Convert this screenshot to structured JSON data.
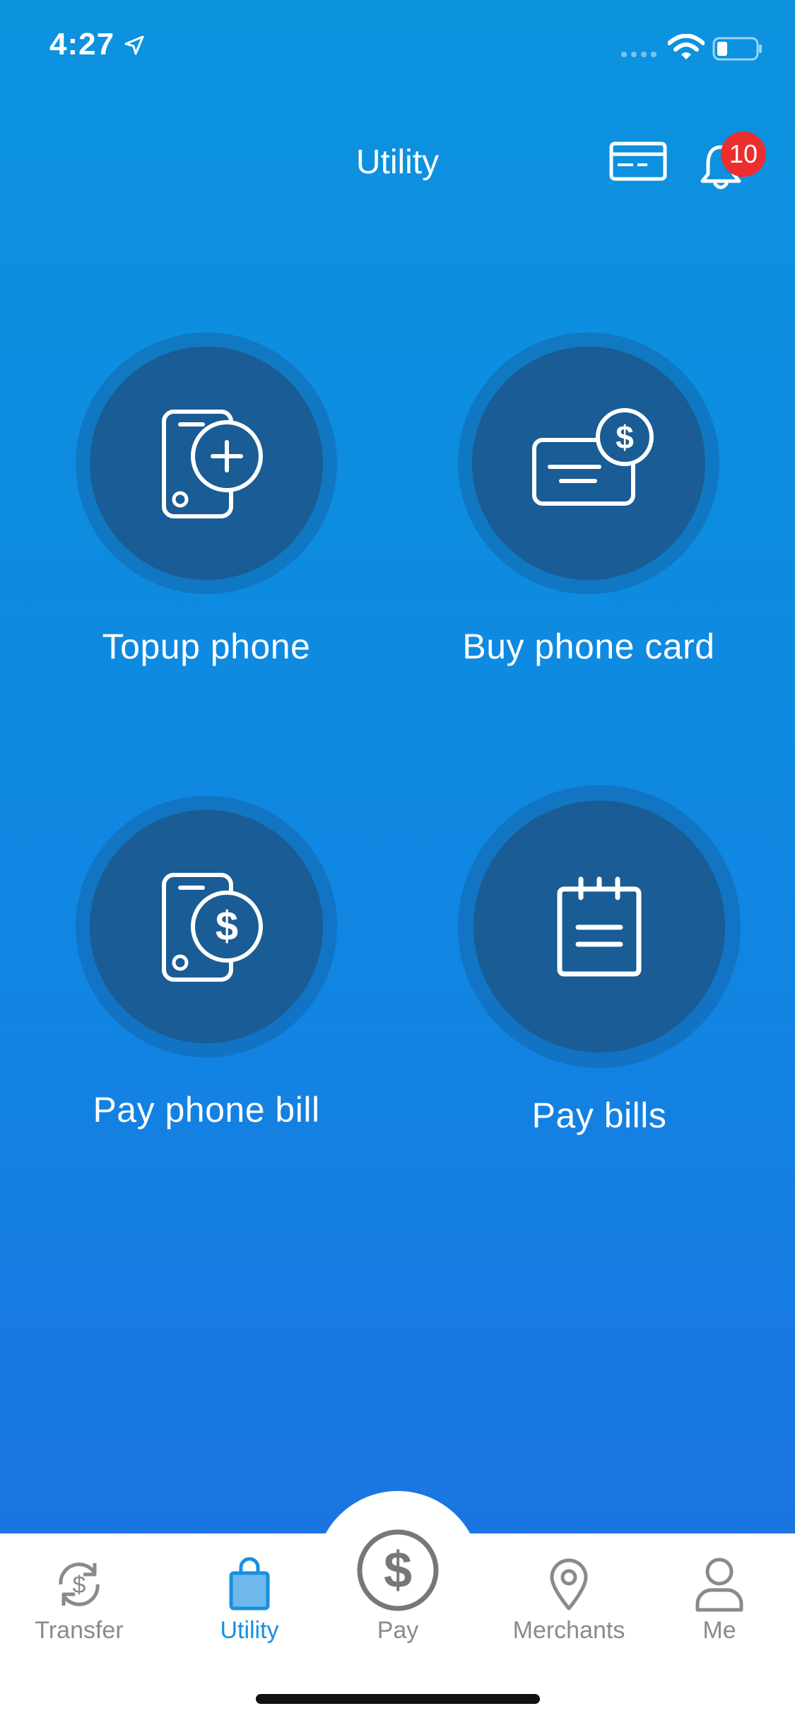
{
  "status_bar": {
    "time": "4:27"
  },
  "header": {
    "title": "Utility",
    "notification_count": "10"
  },
  "tiles": [
    {
      "label": "Topup phone",
      "icon": "phone-plus-icon"
    },
    {
      "label": "Buy phone card",
      "icon": "card-dollar-icon"
    },
    {
      "label": "Pay phone bill",
      "icon": "phone-dollar-icon"
    },
    {
      "label": "Pay bills",
      "icon": "clipboard-icon"
    }
  ],
  "tabbar": {
    "active": "Utility",
    "items": [
      {
        "label": "Transfer",
        "icon": "transfer-icon"
      },
      {
        "label": "Utility",
        "icon": "shopping-bag-icon"
      },
      {
        "label": "Pay",
        "icon": "dollar-circle-icon"
      },
      {
        "label": "Merchants",
        "icon": "location-pin-icon"
      },
      {
        "label": "Me",
        "icon": "person-icon"
      }
    ]
  },
  "colors": {
    "background_top": "#0c93de",
    "background_bottom": "#1f6fe0",
    "tile_inner": "#1a5c95",
    "badge": "#ec2e2e",
    "tab_active": "#1a8fe0",
    "tab_inactive": "#8a8a8a"
  }
}
